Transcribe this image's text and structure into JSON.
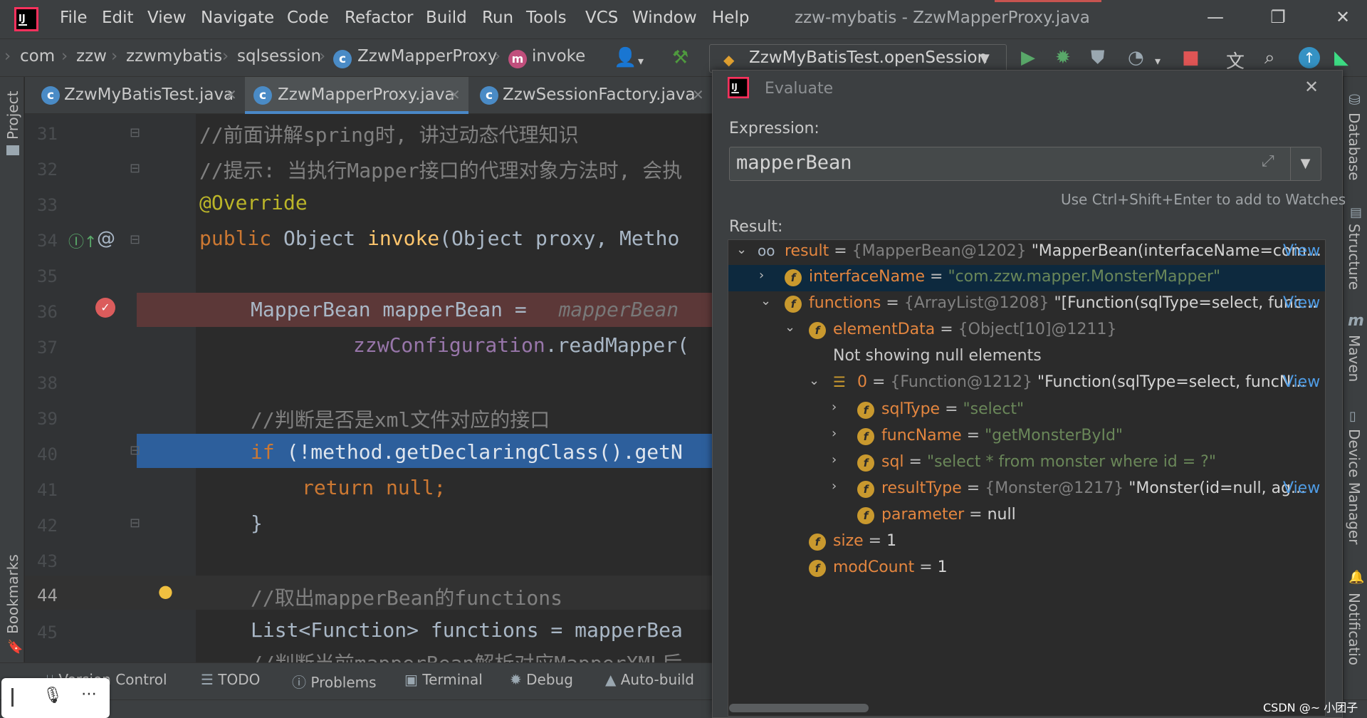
{
  "menubar": {
    "items": [
      "File",
      "Edit",
      "View",
      "Navigate",
      "Code",
      "Refactor",
      "Build",
      "Run",
      "Tools",
      "VCS",
      "Window",
      "Help"
    ],
    "title": "zzw-mybatis - ZzwMapperProxy.java"
  },
  "breadcrumb": {
    "items": [
      "com",
      "zzw",
      "zzwmybatis",
      "sqlsession",
      "ZzwMapperProxy",
      "invoke"
    ]
  },
  "run_config": {
    "label": "ZzwMyBatisTest.openSession"
  },
  "tabs": [
    {
      "label": "ZzwMyBatisTest.java",
      "active": false
    },
    {
      "label": "ZzwMapperProxy.java",
      "active": true
    },
    {
      "label": "ZzwSessionFactory.java",
      "active": false
    }
  ],
  "left_tools": {
    "project": "Project",
    "bookmarks": "Bookmarks"
  },
  "right_tools": {
    "database": "Database",
    "structure": "Structure",
    "maven": "Maven",
    "device_manager": "Device Manager",
    "notifications": "Notificatio"
  },
  "editor": {
    "line_numbers": [
      "31",
      "32",
      "33",
      "34",
      "35",
      "36",
      "37",
      "38",
      "39",
      "40",
      "41",
      "42",
      "43",
      "44",
      "45"
    ],
    "current_line": "44",
    "lines": {
      "l31": "//前面讲解spring时, 讲过动态代理知识",
      "l32": "//提示: 当执行Mapper接口的代理对象方法时, 会执",
      "l33": "@Override",
      "l34_kw": "public",
      "l34_type": " Object ",
      "l34_fn": "invoke",
      "l34_rest": "(Object proxy, Metho",
      "l36_code": "MapperBean mapperBean = ",
      "l36_hint": "mapperBean",
      "l37_field": "zzwConfiguration",
      "l37_rest": ".readMapper(",
      "l39": "//判断是否是xml文件对应的接口",
      "l40_kw": "if",
      "l40_rest": " (!method.getDeclaringClass().getN",
      "l41": "return null;",
      "l42": "}",
      "l44": "//取出mapperBean的functions",
      "l45": "List<Function> functions = mapperBea",
      "l46": "//判断当前mapperBean解析对应MapperXML后"
    }
  },
  "bottom_tools": [
    "Version Control",
    "TODO",
    "Problems",
    "Terminal",
    "Debug",
    "Auto-build"
  ],
  "evaluate": {
    "title": "Evaluate",
    "expression_label": "Expression:",
    "expression": "mapperBean",
    "watch_hint": "Use Ctrl+Shift+Enter to add to Watches",
    "result_label": "Result:",
    "tree": [
      {
        "name": "result",
        "type": "{MapperBean@1202}",
        "value": "\"MapperBean(interfaceName=com...",
        "view": "View"
      },
      {
        "name": "interfaceName",
        "value": "\"com.zzw.mapper.MonsterMapper\""
      },
      {
        "name": "functions",
        "type": "{ArrayList@1208}",
        "value": "\"[Function(sqlType=select, func...",
        "view": "View"
      },
      {
        "name": "elementData",
        "type": "{Object[10]@1211}"
      },
      {
        "message": "Not showing null elements"
      },
      {
        "name": "0",
        "type": "{Function@1212}",
        "value": "\"Function(sqlType=select, funcN...",
        "view": "View"
      },
      {
        "name": "sqlType",
        "value": "\"select\""
      },
      {
        "name": "funcName",
        "value": "\"getMonsterById\""
      },
      {
        "name": "sql",
        "value": "\"select * from monster where id = ?\""
      },
      {
        "name": "resultType",
        "type": "{Monster@1217}",
        "value": "\"Monster(id=null, ag...",
        "view": "View"
      },
      {
        "name": "parameter",
        "value": "null"
      },
      {
        "name": "size",
        "value": "1"
      },
      {
        "name": "modCount",
        "value": "1"
      }
    ]
  },
  "watermark": "CSDN @~ 小团子",
  "colors": {
    "accent": "#4a88c7",
    "breakpoint": "#c75450",
    "selection": "#0d293e"
  }
}
